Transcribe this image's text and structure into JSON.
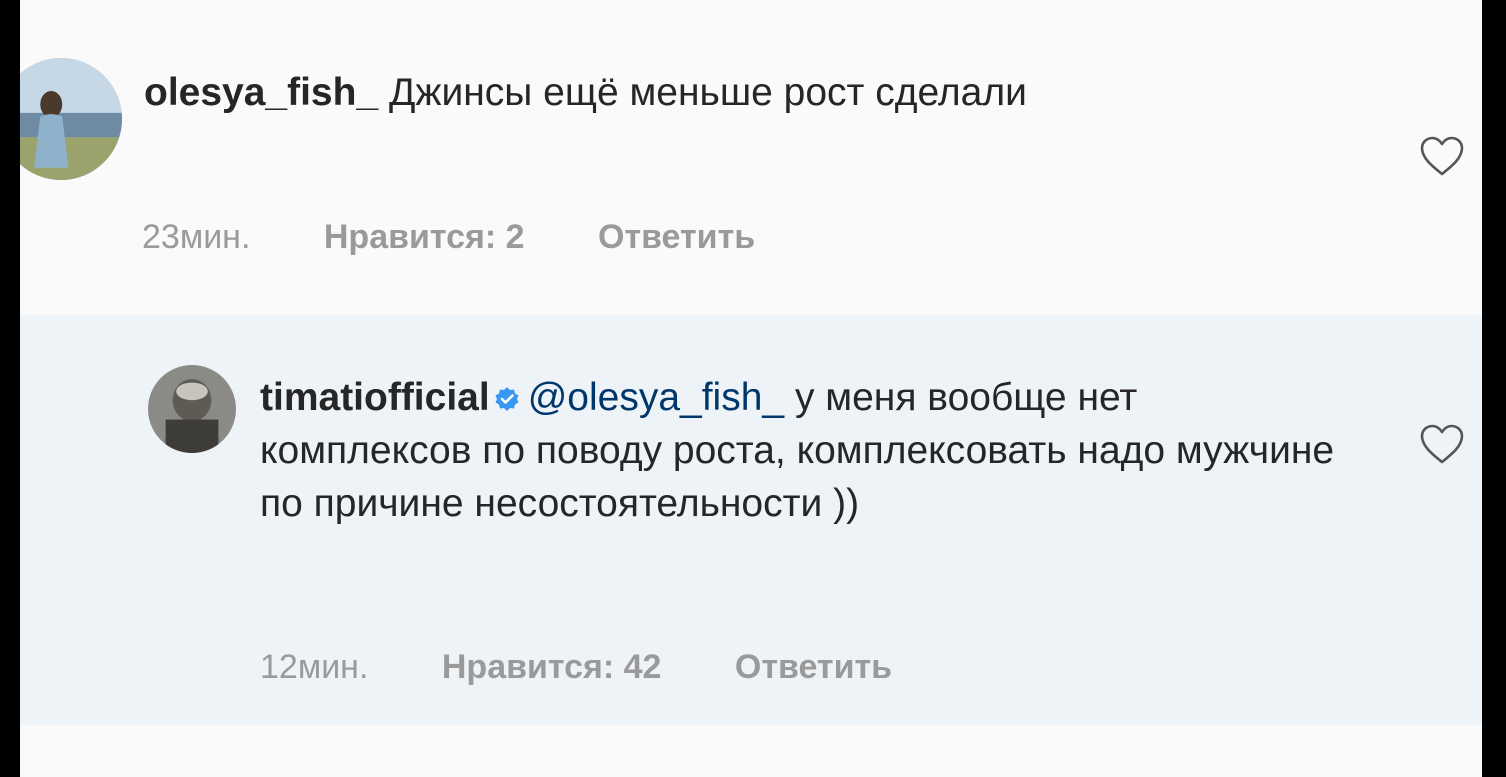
{
  "comments": [
    {
      "username": "olesya_fish_",
      "text": "Джинсы ещё меньше рост сделали",
      "time": "23мин.",
      "likes_label": "Нравится: 2",
      "reply_label": "Ответить",
      "like_icon": "heart-outline-icon"
    },
    {
      "username": "timatiofficial",
      "verified_icon": "verified-badge-icon",
      "mention": "@olesya_fish_",
      "text": "у меня вообще нет комплексов по поводу роста, комплексовать надо мужчине по причине несостоятельности ))",
      "time": "12мин.",
      "likes_label": "Нравится: 42",
      "reply_label": "Ответить",
      "like_icon": "heart-outline-icon"
    }
  ],
  "colors": {
    "background": "#fafafa",
    "reply_background": "#eef3f8",
    "text": "#262626",
    "meta": "#9a9a9a",
    "mention": "#00376b",
    "verified": "#3897f0"
  }
}
